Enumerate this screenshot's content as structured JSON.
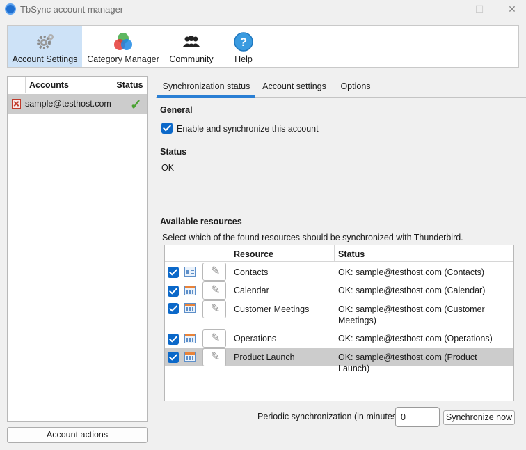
{
  "window": {
    "title": "TbSync account manager",
    "min": "—",
    "max": "☐",
    "close": "✕"
  },
  "toolbar": {
    "items": [
      {
        "label": "Account Settings",
        "icon": "gear-icon"
      },
      {
        "label": "Category Manager",
        "icon": "category-circles-icon"
      },
      {
        "label": "Community",
        "icon": "people-icon"
      },
      {
        "label": "Help",
        "icon": "help-icon"
      }
    ]
  },
  "accounts": {
    "col_accounts": "Accounts",
    "col_status": "Status",
    "rows": [
      {
        "email": "sample@testhost.com",
        "status_icon": "checkmark-icon"
      }
    ],
    "actions_label": "Account actions"
  },
  "tabs": [
    "Synchronization status",
    "Account settings",
    "Options"
  ],
  "general": {
    "heading": "General",
    "enable_label": "Enable and synchronize this account"
  },
  "status": {
    "heading": "Status",
    "value": "OK"
  },
  "resources": {
    "heading": "Available resources",
    "description": "Select which of the found resources should be synchronized with Thunderbird.",
    "col_resource": "Resource",
    "col_status": "Status",
    "rows": [
      {
        "name": "Contacts",
        "status": "OK: sample@testhost.com (Contacts)",
        "icon": "address-book-icon"
      },
      {
        "name": "Calendar",
        "status": "OK: sample@testhost.com (Calendar)",
        "icon": "calendar-icon"
      },
      {
        "name": "Customer Meetings",
        "status": "OK: sample@testhost.com (Customer Meetings)",
        "icon": "calendar-icon"
      },
      {
        "name": "Operations",
        "status": "OK: sample@testhost.com (Operations)",
        "icon": "calendar-icon"
      },
      {
        "name": "Product Launch",
        "status": "OK: sample@testhost.com (Product Launch)",
        "icon": "calendar-icon"
      }
    ]
  },
  "periodic": {
    "label": "Periodic synchronization (in minutes)",
    "value": "0"
  },
  "sync_now_label": "Synchronize now",
  "colors": {
    "accent": "#0b68c9",
    "selected_toolbar": "#cde2f7",
    "selected_row": "#cccccc",
    "ok_check": "#4aa232"
  }
}
